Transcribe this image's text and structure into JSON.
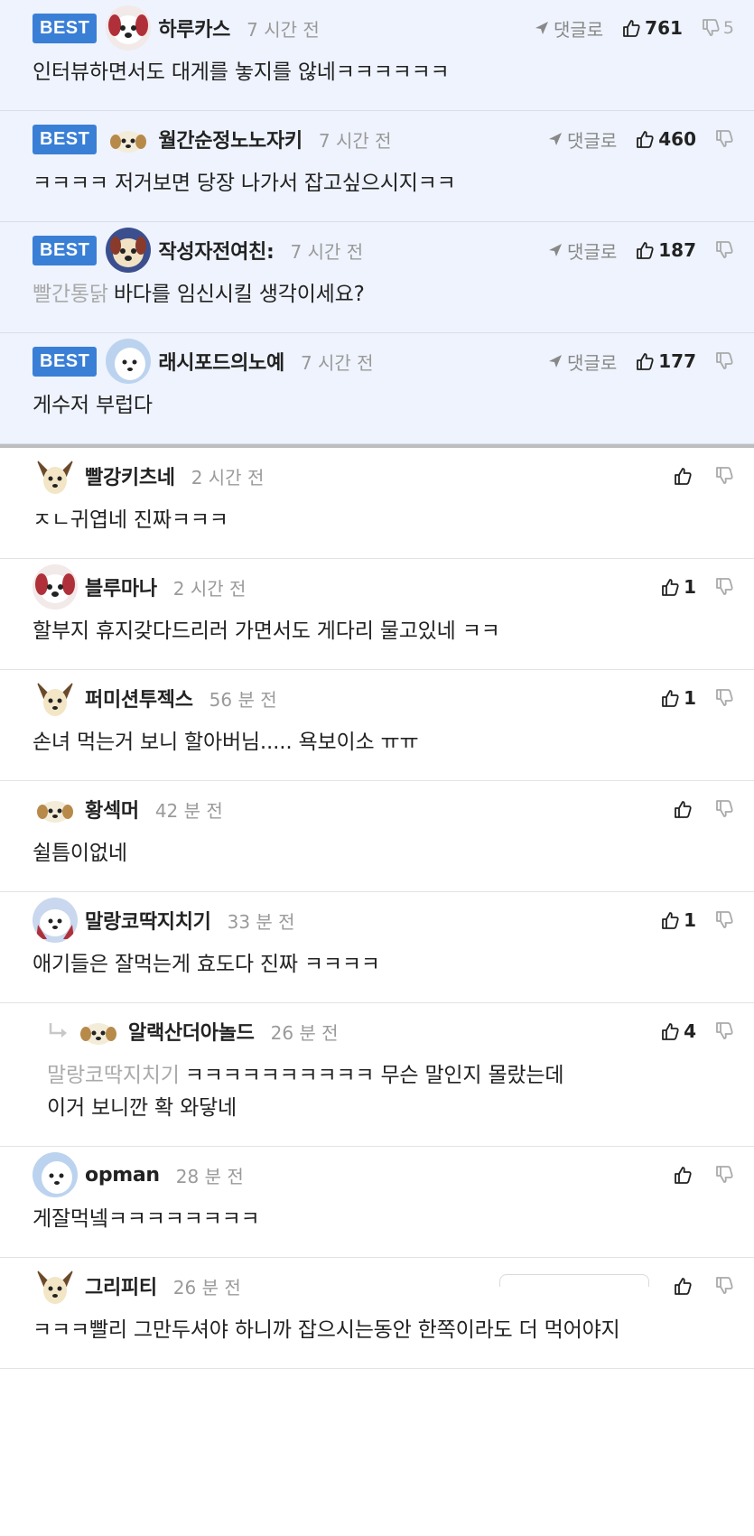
{
  "best_label": "BEST",
  "reply_label": "댓글로",
  "best_comments": [
    {
      "nick": "하루카스",
      "time": "7 시간 전",
      "likes": "761",
      "dislikes": "5",
      "text": "인터뷰하면서도 대게를 놓지를 않네ㅋㅋㅋㅋㅋㅋ"
    },
    {
      "nick": "월간순정노노자키",
      "time": "7 시간 전",
      "likes": "460",
      "dislikes": "",
      "text": "ㅋㅋㅋㅋ 저거보면 당장 나가서 잡고싶으시지ㅋㅋ"
    },
    {
      "nick": "작성자전여친:",
      "time": "7 시간 전",
      "likes": "187",
      "dislikes": "",
      "mention": "빨간통닭",
      "text": "바다를 임신시킬 생각이세요?"
    },
    {
      "nick": "래시포드의노예",
      "time": "7 시간 전",
      "likes": "177",
      "dislikes": "",
      "text": "게수저 부럽다"
    }
  ],
  "comments": [
    {
      "nick": "빨강키츠네",
      "time": "2 시간 전",
      "likes": "",
      "text": "ㅈㄴ귀엽네 진짜ㅋㅋㅋ"
    },
    {
      "nick": "블루마나",
      "time": "2 시간 전",
      "likes": "1",
      "text": "할부지 휴지갖다드리러 가면서도 게다리 물고있네 ㅋㅋ"
    },
    {
      "nick": "퍼미션투젝스",
      "time": "56 분 전",
      "likes": "1",
      "text": "손녀 먹는거 보니 할아버님..... 욕보이소 ㅠㅠ"
    },
    {
      "nick": "황섹머",
      "time": "42 분 전",
      "likes": "",
      "text": "쉴틈이없네"
    },
    {
      "nick": "말랑코딱지치기",
      "time": "33 분 전",
      "likes": "1",
      "text": "애기들은 잘먹는게 효도다 진짜 ㅋㅋㅋㅋ"
    },
    {
      "nick": "알랙산더아놀드",
      "time": "26 분 전",
      "likes": "4",
      "mention": "말랑코딱지치기",
      "text": "ㅋㅋㅋㅋㅋㅋㅋㅋㅋㅋ 무슨 말인지 몰랐는데",
      "text2": "이거 보니깐 확 와닿네"
    },
    {
      "nick": "opman",
      "time": "28 분 전",
      "likes": "",
      "text": "게잘먹넼ㅋㅋㅋㅋㅋㅋㅋㅋ"
    },
    {
      "nick": "그리피티",
      "time": "26 분 전",
      "likes": "",
      "text": "ㅋㅋㅋ빨리 그만두셔야 하니까 잡으시는동안 한쪽이라도 더 먹어야지"
    }
  ]
}
